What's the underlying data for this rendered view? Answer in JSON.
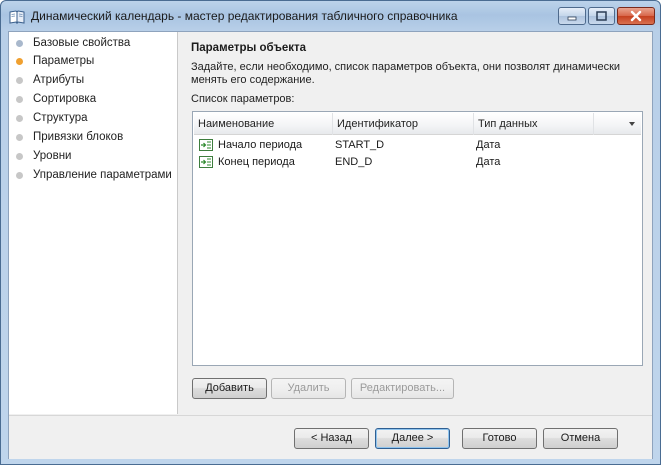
{
  "window": {
    "title": "Динамический календарь - мастер редактирования табличного справочника"
  },
  "sidebar": {
    "items": [
      {
        "label": "Базовые свойства",
        "state": "done"
      },
      {
        "label": "Параметры",
        "state": "active"
      },
      {
        "label": "Атрибуты",
        "state": "pending"
      },
      {
        "label": "Сортировка",
        "state": "pending"
      },
      {
        "label": "Структура",
        "state": "pending"
      },
      {
        "label": "Привязки блоков",
        "state": "pending"
      },
      {
        "label": "Уровни",
        "state": "pending"
      },
      {
        "label": "Управление параметрами",
        "state": "pending"
      }
    ]
  },
  "main": {
    "title": "Параметры объекта",
    "description": "Задайте, если необходимо, список параметров объекта, они позволят динамически менять его содержание.",
    "list_label": "Список параметров:",
    "table": {
      "columns": [
        "Наименование",
        "Идентификатор",
        "Тип данных"
      ],
      "rows": [
        {
          "name": "Начало периода",
          "id": "START_D",
          "type": "Дата"
        },
        {
          "name": "Конец периода",
          "id": "END_D",
          "type": "Дата"
        }
      ]
    },
    "buttons": {
      "add": "Добавить",
      "delete": "Удалить",
      "edit": "Редактировать..."
    }
  },
  "footer": {
    "back": "< Назад",
    "next": "Далее >",
    "finish": "Готово",
    "cancel": "Отмена"
  },
  "colors": {
    "active_step": "#f0a030",
    "titlebar": "#bcd3ea",
    "close_button": "#c5401f"
  }
}
